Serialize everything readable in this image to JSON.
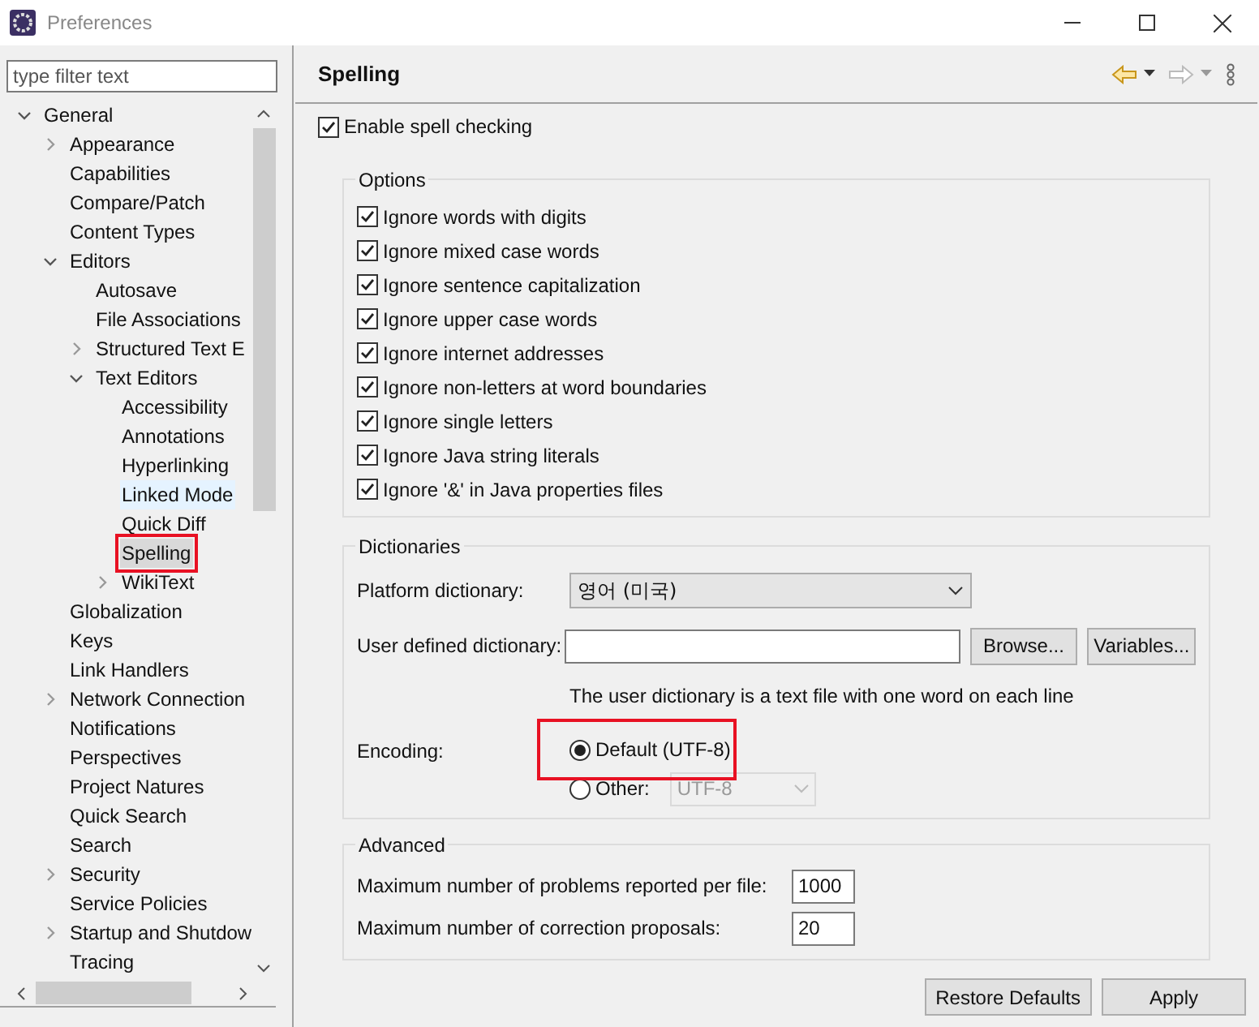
{
  "window": {
    "title": "Preferences"
  },
  "filter": {
    "placeholder": "type filter text"
  },
  "tree": [
    {
      "label": "General",
      "expanded": true,
      "selected": false,
      "hovered": false,
      "annotated": false,
      "children": [
        {
          "label": "Appearance",
          "expanded": false,
          "selected": false,
          "hovered": false,
          "annotated": false
        },
        {
          "label": "Capabilities",
          "selected": false,
          "hovered": false,
          "annotated": false
        },
        {
          "label": "Compare/Patch",
          "selected": false,
          "hovered": false,
          "annotated": false
        },
        {
          "label": "Content Types",
          "selected": false,
          "hovered": false,
          "annotated": false
        },
        {
          "label": "Editors",
          "expanded": true,
          "selected": false,
          "hovered": false,
          "annotated": false,
          "children": [
            {
              "label": "Autosave",
              "selected": false,
              "hovered": false,
              "annotated": false
            },
            {
              "label": "File Associations",
              "selected": false,
              "hovered": false,
              "annotated": false
            },
            {
              "label": "Structured Text E",
              "expanded": false,
              "selected": false,
              "hovered": false,
              "annotated": false
            },
            {
              "label": "Text Editors",
              "expanded": true,
              "selected": false,
              "hovered": false,
              "annotated": false,
              "children": [
                {
                  "label": "Accessibility",
                  "selected": false,
                  "hovered": false,
                  "annotated": false
                },
                {
                  "label": "Annotations",
                  "selected": false,
                  "hovered": false,
                  "annotated": false
                },
                {
                  "label": "Hyperlinking",
                  "selected": false,
                  "hovered": false,
                  "annotated": false
                },
                {
                  "label": "Linked Mode",
                  "selected": false,
                  "hovered": true,
                  "annotated": false
                },
                {
                  "label": "Quick Diff",
                  "selected": false,
                  "hovered": false,
                  "annotated": false
                },
                {
                  "label": "Spelling",
                  "selected": true,
                  "hovered": false,
                  "annotated": true
                },
                {
                  "label": "WikiText",
                  "expanded": false,
                  "selected": false,
                  "hovered": false,
                  "annotated": false
                }
              ]
            }
          ]
        },
        {
          "label": "Globalization",
          "selected": false,
          "hovered": false,
          "annotated": false
        },
        {
          "label": "Keys",
          "selected": false,
          "hovered": false,
          "annotated": false
        },
        {
          "label": "Link Handlers",
          "selected": false,
          "hovered": false,
          "annotated": false
        },
        {
          "label": "Network Connection",
          "expanded": false,
          "selected": false,
          "hovered": false,
          "annotated": false
        },
        {
          "label": "Notifications",
          "selected": false,
          "hovered": false,
          "annotated": false
        },
        {
          "label": "Perspectives",
          "selected": false,
          "hovered": false,
          "annotated": false
        },
        {
          "label": "Project Natures",
          "selected": false,
          "hovered": false,
          "annotated": false
        },
        {
          "label": "Quick Search",
          "selected": false,
          "hovered": false,
          "annotated": false
        },
        {
          "label": "Search",
          "selected": false,
          "hovered": false,
          "annotated": false
        },
        {
          "label": "Security",
          "expanded": false,
          "selected": false,
          "hovered": false,
          "annotated": false
        },
        {
          "label": "Service Policies",
          "selected": false,
          "hovered": false,
          "annotated": false
        },
        {
          "label": "Startup and Shutdow",
          "expanded": false,
          "selected": false,
          "hovered": false,
          "annotated": false
        },
        {
          "label": "Tracing",
          "selected": false,
          "hovered": false,
          "annotated": false
        }
      ]
    }
  ],
  "page": {
    "title": "Spelling",
    "enable": {
      "label": "Enable spell checking",
      "checked": true
    },
    "options": {
      "title": "Options",
      "items": [
        {
          "label": "Ignore words with digits",
          "checked": true
        },
        {
          "label": "Ignore mixed case words",
          "checked": true
        },
        {
          "label": "Ignore sentence capitalization",
          "checked": true
        },
        {
          "label": "Ignore upper case words",
          "checked": true
        },
        {
          "label": "Ignore internet addresses",
          "checked": true
        },
        {
          "label": "Ignore non-letters at word boundaries",
          "checked": true
        },
        {
          "label": "Ignore single letters",
          "checked": true
        },
        {
          "label": "Ignore Java string literals",
          "checked": true
        },
        {
          "label": "Ignore '&' in Java properties files",
          "checked": true
        }
      ]
    },
    "dictionaries": {
      "title": "Dictionaries",
      "platform": {
        "label": "Platform dictionary:",
        "value": "영어 (미국)"
      },
      "user": {
        "label": "User defined dictionary:",
        "buttons": [
          "Browse...",
          "Variables..."
        ]
      },
      "hint": "The user dictionary is a text file with one word on each line",
      "encoding": {
        "label": "Encoding:",
        "options": [
          {
            "label": "Default (UTF-8)",
            "selected": true,
            "annotated": true
          },
          {
            "label": "Other:",
            "selected": false,
            "annotated": false
          }
        ],
        "other_value": "UTF-8"
      }
    },
    "advanced": {
      "title": "Advanced",
      "fields": [
        {
          "label": "Maximum number of problems reported per file:",
          "value": "1000"
        },
        {
          "label": "Maximum number of correction proposals:",
          "value": "20"
        }
      ]
    },
    "buttons": [
      "Restore Defaults",
      "Apply"
    ]
  }
}
